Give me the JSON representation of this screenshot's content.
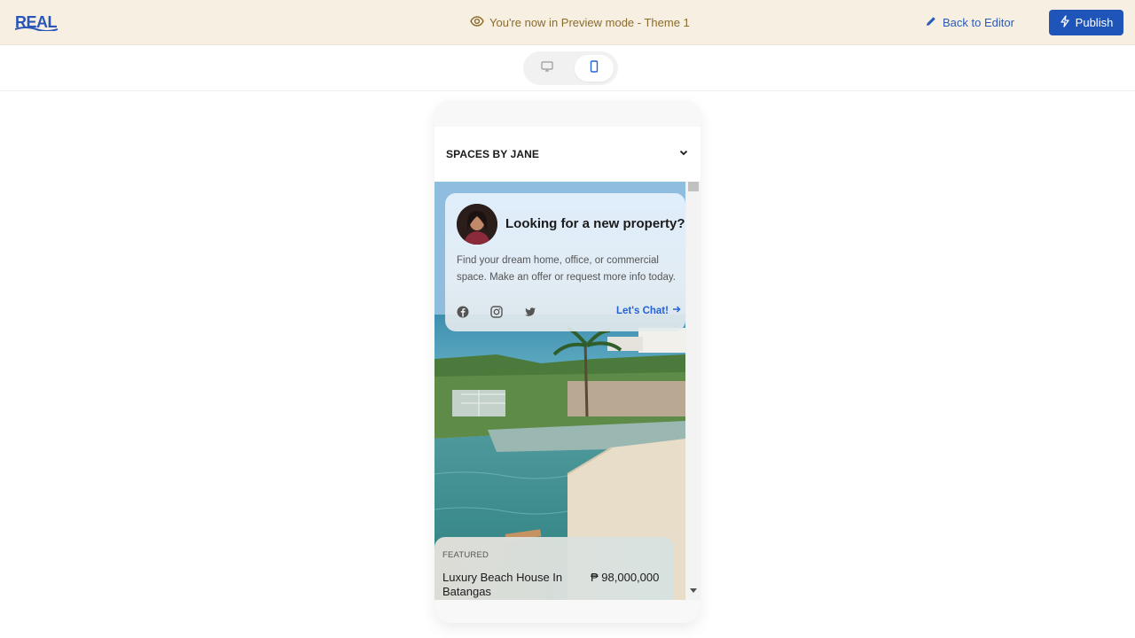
{
  "topbar": {
    "logo_text": "REAL",
    "preview_message": "You're now in Preview mode - Theme 1",
    "back_to_editor": "Back to Editor",
    "publish": "Publish",
    "accent_color": "#1f55b8",
    "banner_color": "#f7efe1"
  },
  "device_toggle": {
    "options": [
      "desktop-icon",
      "mobile-icon"
    ],
    "selected": "mobile"
  },
  "site": {
    "name": "SPACES BY JANE",
    "intro": {
      "title": "Looking for a new property?",
      "text": "Find your dream home, office, or commercial space. Make an offer or request more info today.",
      "cta": "Let's Chat!",
      "socials": [
        "facebook-icon",
        "instagram-icon",
        "twitter-icon"
      ]
    },
    "featured": {
      "label": "FEATURED",
      "title": "Luxury Beach House In Batangas",
      "price": "₱ 98,000,000"
    }
  }
}
